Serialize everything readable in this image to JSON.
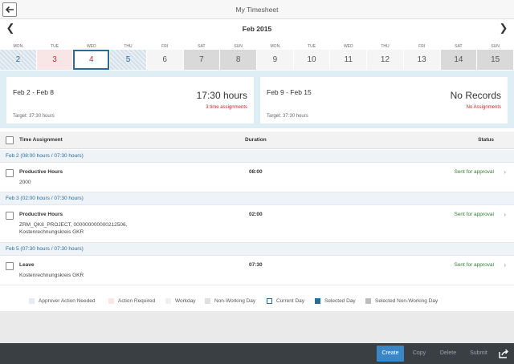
{
  "app": {
    "title": "My Timesheet"
  },
  "calendar": {
    "month": "Feb 2015",
    "days": [
      {
        "name": "MON",
        "num": "2",
        "state": "approver"
      },
      {
        "name": "TUE",
        "num": "3",
        "state": "action"
      },
      {
        "name": "WED",
        "num": "4",
        "state": "current"
      },
      {
        "name": "THU",
        "num": "5",
        "state": "approver"
      },
      {
        "name": "FRI",
        "num": "6",
        "state": "workday"
      },
      {
        "name": "SAT",
        "num": "7",
        "state": "nonwork"
      },
      {
        "name": "SUN",
        "num": "8",
        "state": "nonwork"
      },
      {
        "name": "MON",
        "num": "9",
        "state": "workday"
      },
      {
        "name": "TUE",
        "num": "10",
        "state": "workday"
      },
      {
        "name": "WED",
        "num": "11",
        "state": "workday"
      },
      {
        "name": "THU",
        "num": "12",
        "state": "workday"
      },
      {
        "name": "FRI",
        "num": "13",
        "state": "workday"
      },
      {
        "name": "SAT",
        "num": "14",
        "state": "nonwork"
      },
      {
        "name": "SUN",
        "num": "15",
        "state": "nonwork"
      }
    ]
  },
  "weeks": [
    {
      "range": "Feb 2 - Feb 8",
      "hours": "17:30 hours",
      "assignments": "3 time assignments",
      "target": "Target: 37:30 hours"
    },
    {
      "range": "Feb 9 - Feb 15",
      "hours": "No Records",
      "assignments": "No Assignments",
      "target": "Target: 37:30 hours"
    }
  ],
  "table": {
    "headers": {
      "assignment": "Time Assignment",
      "duration": "Duration",
      "status": "Status"
    },
    "groups": [
      {
        "label": "Feb 2 (08:00 hours / 07:30 hours)",
        "row": {
          "title": "Productive Hours",
          "sub": "2000",
          "duration": "08:00",
          "status": "Sent for approval"
        }
      },
      {
        "label": "Feb 3 (02:00 hours / 07:30 hours)",
        "row": {
          "title": "Productive Hours",
          "sub": "ZRM_QK8_PROJECT, 000000000000212506, Kostenrechnungskreis GKR",
          "duration": "02:00",
          "status": "Sent for approval"
        }
      },
      {
        "label": "Feb 5 (07:30 hours / 07:30 hours)",
        "row": {
          "title": "Leave",
          "sub": "Kostenrechnungskreis GKR",
          "duration": "07:30",
          "status": "Sent for approval"
        }
      }
    ]
  },
  "legend": [
    {
      "label": "Approver Action Needed",
      "color": "#dde6ee"
    },
    {
      "label": "Action Required",
      "color": "#f8e6e6"
    },
    {
      "label": "Workday",
      "color": "#f0f0f0"
    },
    {
      "label": "Non-Working Day",
      "color": "#e0e0e0"
    },
    {
      "label": "Current Day",
      "color": "#ffffff"
    },
    {
      "label": "Selected Day",
      "color": "#2b6a99"
    },
    {
      "label": "Selected Non-Working Day",
      "color": "#bdbdbd"
    }
  ],
  "footer": {
    "create": "Create",
    "copy": "Copy",
    "delete": "Delete",
    "submit": "Submit",
    "share_icon": "share-icon"
  }
}
